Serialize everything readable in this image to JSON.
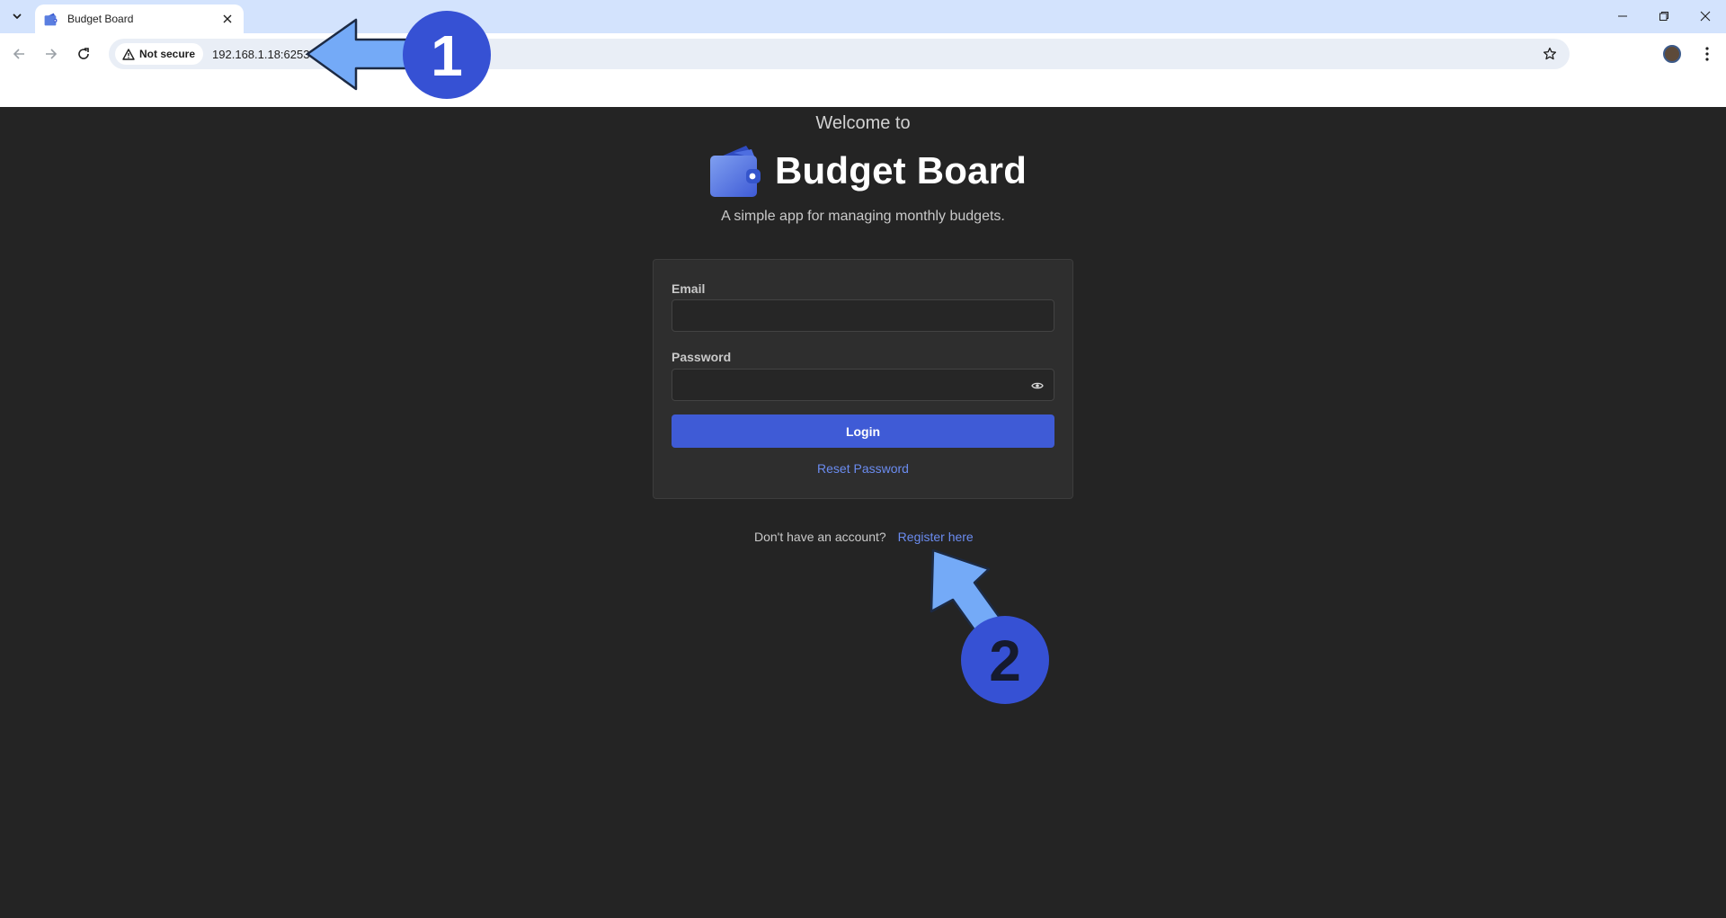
{
  "browser": {
    "tab_title": "Budget Board",
    "security_chip": "Not secure",
    "url": "192.168.1.18:6253"
  },
  "page": {
    "welcome": "Welcome to",
    "brand_name": "Budget Board",
    "tagline": "A simple app for managing monthly budgets.",
    "form": {
      "email_label": "Email",
      "email_value": "",
      "password_label": "Password",
      "password_value": "",
      "login_label": "Login",
      "reset_label": "Reset Password"
    },
    "register_prompt": "Don't have an account?",
    "register_link": "Register here"
  },
  "annotations": [
    {
      "number": "1"
    },
    {
      "number": "2"
    }
  ],
  "colors": {
    "page_bg": "#242424",
    "card_bg": "#2e2e2e",
    "accent": "#3f5bd6",
    "link": "#6b8cf0",
    "annotation_arrow": "#74aaf7",
    "annotation_badge": "#3651d4"
  },
  "icons": [
    "chevron-down-icon",
    "wallet-icon",
    "close-icon",
    "minimize-icon",
    "restore-icon",
    "back-arrow-icon",
    "forward-arrow-icon",
    "reload-icon",
    "warning-icon",
    "star-icon",
    "kebab-menu-icon",
    "eye-icon"
  ]
}
